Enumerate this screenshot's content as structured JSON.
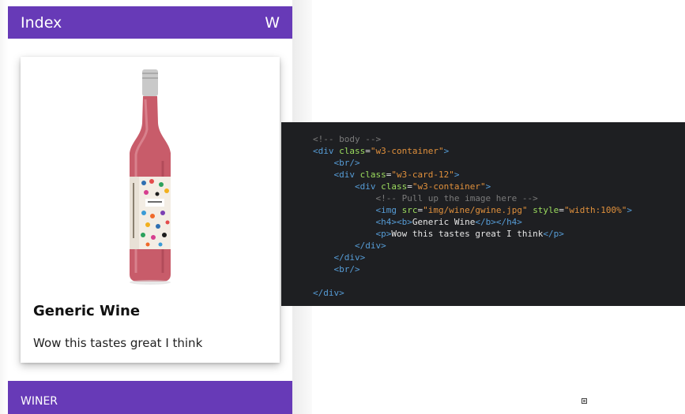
{
  "app": {
    "title": "Index",
    "action_label": "W",
    "card": {
      "title": "Generic Wine",
      "text": "Wow this tastes great I think",
      "image_alt": "rose wine bottle"
    },
    "footer_label": "WINER",
    "colors": {
      "primary": "#673ab7",
      "wine": "#c85c6a"
    }
  },
  "code": {
    "lines": [
      {
        "indent": "",
        "parts": [
          {
            "t": "com",
            "v": "<!-- body -->"
          }
        ]
      },
      {
        "indent": "",
        "parts": [
          {
            "t": "tag",
            "v": "<div "
          },
          {
            "t": "attr",
            "v": "class"
          },
          {
            "t": "txt",
            "v": "="
          },
          {
            "t": "str",
            "v": "\"w3-container\""
          },
          {
            "t": "tag",
            "v": ">"
          }
        ]
      },
      {
        "indent": "    ",
        "parts": [
          {
            "t": "tag",
            "v": "<br/>"
          }
        ]
      },
      {
        "indent": "    ",
        "parts": [
          {
            "t": "tag",
            "v": "<div "
          },
          {
            "t": "attr",
            "v": "class"
          },
          {
            "t": "txt",
            "v": "="
          },
          {
            "t": "str",
            "v": "\"w3-card-12\""
          },
          {
            "t": "tag",
            "v": ">"
          }
        ]
      },
      {
        "indent": "        ",
        "parts": [
          {
            "t": "tag",
            "v": "<div "
          },
          {
            "t": "attr",
            "v": "class"
          },
          {
            "t": "txt",
            "v": "="
          },
          {
            "t": "str",
            "v": "\"w3-container\""
          },
          {
            "t": "tag",
            "v": ">"
          }
        ]
      },
      {
        "indent": "            ",
        "parts": [
          {
            "t": "com",
            "v": "<!-- Pull up the image here -->"
          }
        ]
      },
      {
        "indent": "            ",
        "parts": [
          {
            "t": "tag",
            "v": "<img "
          },
          {
            "t": "attr",
            "v": "src"
          },
          {
            "t": "txt",
            "v": "="
          },
          {
            "t": "str",
            "v": "\"img/wine/gwine.jpg\""
          },
          {
            "t": "txt",
            "v": " "
          },
          {
            "t": "attr",
            "v": "style"
          },
          {
            "t": "txt",
            "v": "="
          },
          {
            "t": "str",
            "v": "\"width:100%\""
          },
          {
            "t": "tag",
            "v": ">"
          }
        ]
      },
      {
        "indent": "            ",
        "parts": [
          {
            "t": "tag",
            "v": "<h4><b>"
          },
          {
            "t": "txt",
            "v": "Generic Wine"
          },
          {
            "t": "tag",
            "v": "</b></h4>"
          }
        ]
      },
      {
        "indent": "            ",
        "parts": [
          {
            "t": "tag",
            "v": "<p>"
          },
          {
            "t": "txt",
            "v": "Wow this tastes great I think"
          },
          {
            "t": "tag",
            "v": "</p>"
          }
        ]
      },
      {
        "indent": "        ",
        "parts": [
          {
            "t": "tag",
            "v": "</div>"
          }
        ]
      },
      {
        "indent": "    ",
        "parts": [
          {
            "t": "tag",
            "v": "</div>"
          }
        ]
      },
      {
        "indent": "    ",
        "parts": [
          {
            "t": "tag",
            "v": "<br/>"
          }
        ]
      },
      {
        "indent": "",
        "parts": []
      },
      {
        "indent": "",
        "parts": [
          {
            "t": "tag",
            "v": "</div>"
          }
        ]
      }
    ]
  }
}
